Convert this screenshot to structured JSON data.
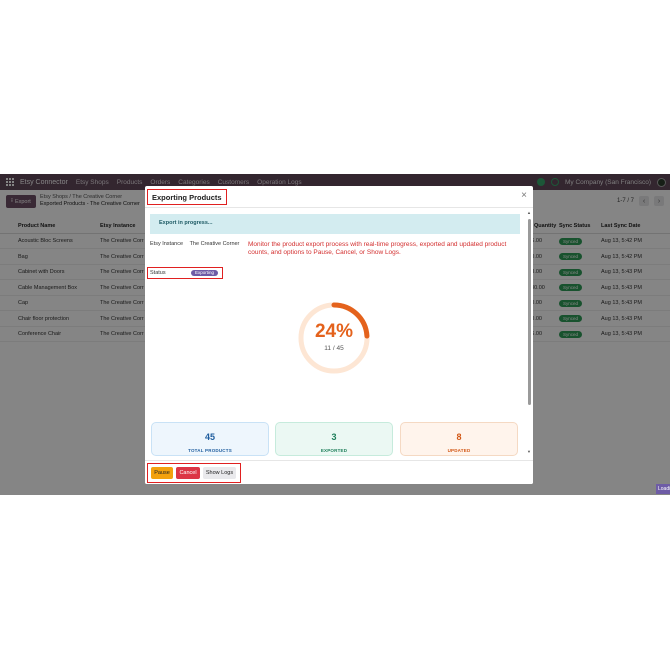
{
  "topnav": {
    "brand": "Etsy Connector",
    "menu": [
      "Etsy Shops",
      "Products",
      "Orders",
      "Categories",
      "Customers",
      "Operation Logs"
    ],
    "company": "My Company (San Francisco)"
  },
  "controlbar": {
    "export_label": "Export",
    "breadcrumb_line1": "Etsy Shops / The Creative Corner",
    "breadcrumb_line2": "Exported Products - The Creative Corner",
    "pager": "1-7 / 7"
  },
  "list": {
    "headers": {
      "name": "Product Name",
      "instance": "Etsy Instance",
      "quantity": "Quantity",
      "sync": "Sync Status",
      "date": "Last Sync Date"
    },
    "rows": [
      {
        "name": "Acoustic Bloc Screens",
        "instance": "The Creative Corr",
        "quantity": "16.00",
        "sync": "Synced",
        "date": "Aug 13, 5:42 PM"
      },
      {
        "name": "Bag",
        "instance": "The Creative Corr",
        "quantity": "0.00",
        "sync": "Synced",
        "date": "Aug 13, 5:42 PM"
      },
      {
        "name": "Cabinet with Doors",
        "instance": "The Creative Corr",
        "quantity": "33.00",
        "sync": "Synced",
        "date": "Aug 13, 5:43 PM"
      },
      {
        "name": "Cable Management Box",
        "instance": "The Creative Corr",
        "quantity": "180.00",
        "sync": "Synced",
        "date": "Aug 13, 5:43 PM"
      },
      {
        "name": "Cap",
        "instance": "The Creative Corr",
        "quantity": "0.00",
        "sync": "Synced",
        "date": "Aug 13, 5:43 PM"
      },
      {
        "name": "Chair floor protection",
        "instance": "The Creative Corr",
        "quantity": "0.00",
        "sync": "Synced",
        "date": "Aug 13, 5:43 PM"
      },
      {
        "name": "Conference Chair",
        "instance": "The Creative Corr",
        "quantity": "56.00",
        "sync": "Synced",
        "date": "Aug 13, 5:43 PM"
      }
    ]
  },
  "dialog": {
    "title": "Exporting Products",
    "close_glyph": "×",
    "banner": "Export in progress...",
    "instance_label": "Etsy Instance",
    "instance_value": "The Creative Corner",
    "status_label": "Status",
    "status_value": "Exporting",
    "annotation": "Monitor the product export process with real-time progress, exported and updated product counts, and options to Pause, Cancel, or Show Logs.",
    "progress": {
      "percent": 24,
      "percent_text": "24%",
      "count_text": "11 / 45"
    },
    "cards": {
      "total": {
        "value": "45",
        "label": "TOTAL PRODUCTS"
      },
      "exported": {
        "value": "3",
        "label": "EXPORTED"
      },
      "updated": {
        "value": "8",
        "label": "UPDATED"
      }
    },
    "buttons": {
      "pause": "Pause",
      "cancel": "Cancel",
      "logs": "Show Logs"
    }
  },
  "load_tag": "Loadi",
  "colors": {
    "nav": "#62495b",
    "accent_orange": "#e4621c",
    "synced_green": "#2e9e58",
    "annotation_red": "#e02020"
  }
}
